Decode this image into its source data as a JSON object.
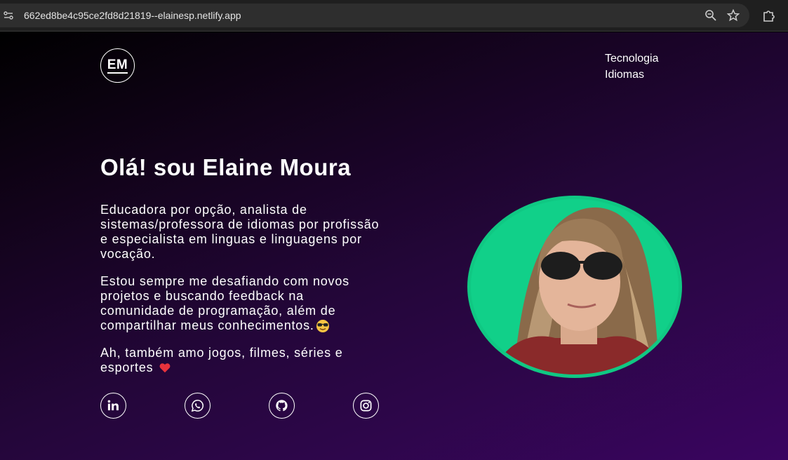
{
  "browser": {
    "url": "662ed8be4c95ce2fd8d21819--elainesp.netlify.app",
    "icons": [
      "site-info-icon",
      "zoom-icon",
      "star-icon",
      "extensions-icon"
    ]
  },
  "header": {
    "logo_text": "EM",
    "nav": [
      {
        "label": "Tecnologia"
      },
      {
        "label": "Idiomas"
      }
    ]
  },
  "hero": {
    "title": "Olá! sou Elaine Moura",
    "paragraphs": [
      "Educadora por opção, analista de sistemas/professora de idiomas por profissão e especialista em linguas e linguagens por vocação.",
      "Estou sempre me desafiando com novos projetos e buscando feedback na comunidade de programação, além de compartilhar meus conhecimentos.",
      "Ah, também amo jogos, filmes, séries e esportes"
    ],
    "emojis": [
      "sunglasses-emoji",
      "heart-emoji"
    ]
  },
  "socials": [
    {
      "name": "linkedin-icon"
    },
    {
      "name": "whatsapp-icon"
    },
    {
      "name": "github-icon"
    },
    {
      "name": "instagram-icon"
    }
  ],
  "colors": {
    "accent_green": "#10c883",
    "background_dark": "#000000",
    "background_purple": "#3a0560"
  }
}
